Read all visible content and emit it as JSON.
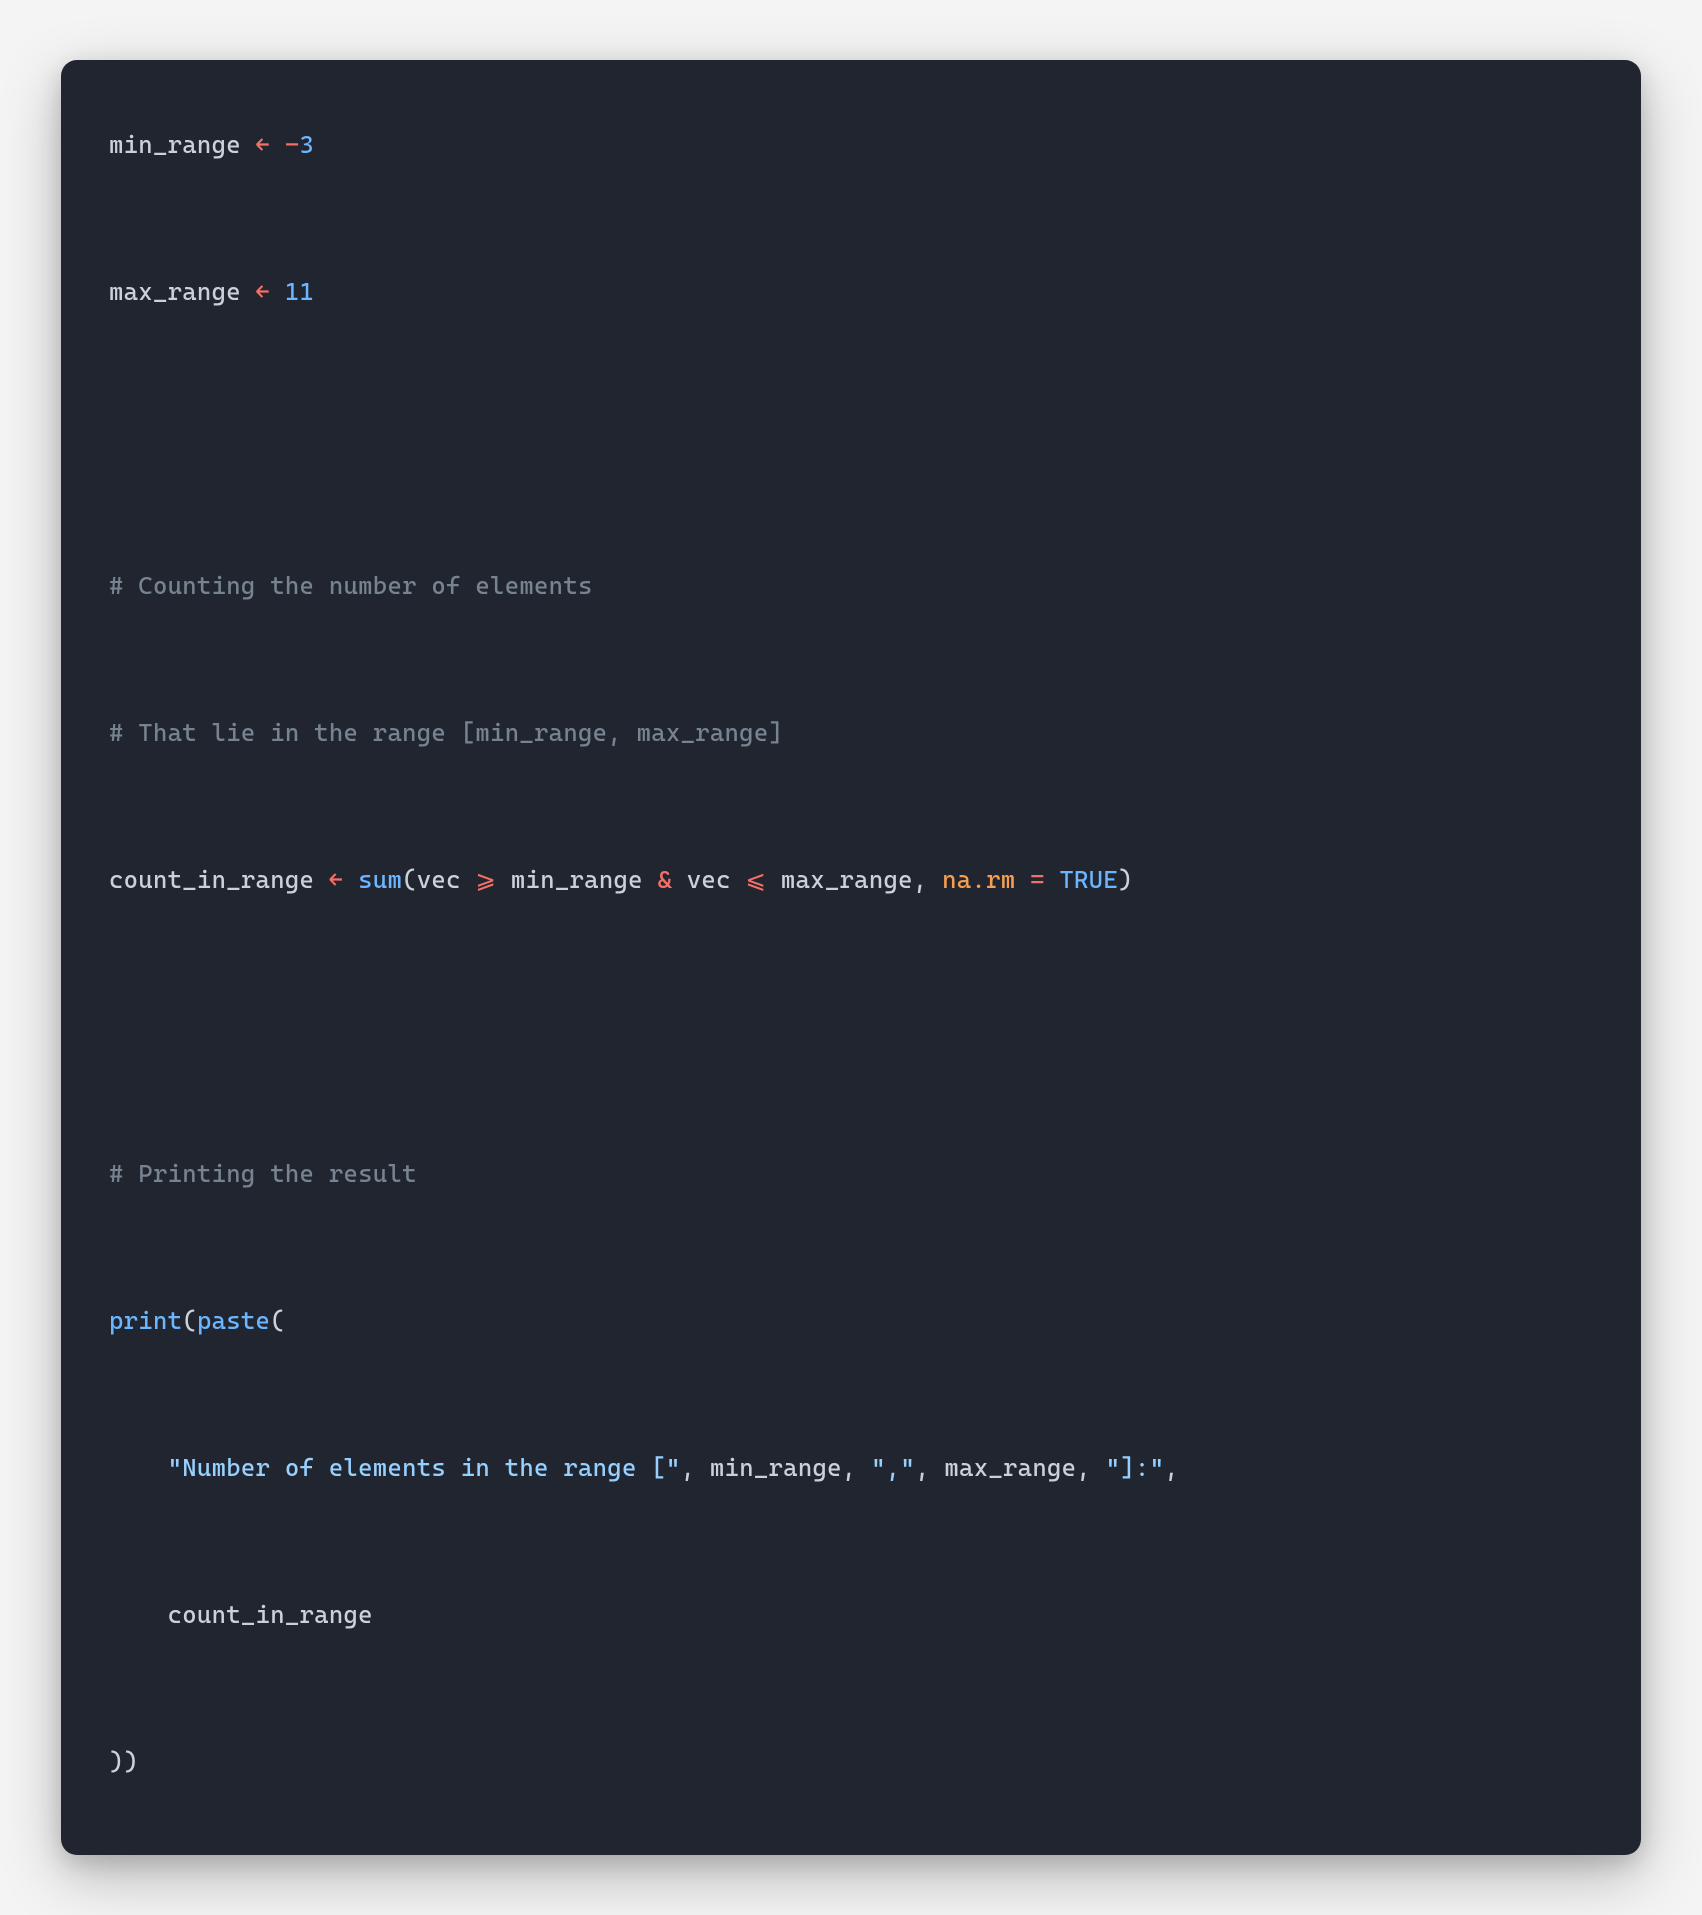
{
  "code": {
    "line1": {
      "var": "min_range",
      "assign": "←",
      "neg": "-",
      "val": "3"
    },
    "line2": {
      "var": "max_range",
      "assign": "←",
      "val": "11"
    },
    "comment1": "# Counting the number of elements",
    "comment2": "# That lie in the range [min_range, max_range]",
    "line3": {
      "var": "count_in_range",
      "assign": "←",
      "func": "sum",
      "open": "(",
      "arg1": "vec",
      "op1": "⩾",
      "arg2": "min_range",
      "amp": "&",
      "arg3": "vec",
      "op2": "⩽",
      "arg4": "max_range",
      "comma1": ",",
      "param": "na.rm",
      "eq": "=",
      "bool": "TRUE",
      "close": ")"
    },
    "comment3": "# Printing the result",
    "line4": {
      "func1": "print",
      "open1": "(",
      "func2": "paste",
      "open2": "("
    },
    "line5": {
      "str1": "\"Number of elements in the range [\"",
      "c1": ",",
      "arg1": "min_range",
      "c2": ",",
      "str2": "\",\"",
      "c3": ",",
      "arg2": "max_range",
      "c4": ",",
      "str3": "\"]:\"",
      "c5": ","
    },
    "line6": {
      "arg": "count_in_range"
    },
    "line7": {
      "close": "))"
    }
  }
}
